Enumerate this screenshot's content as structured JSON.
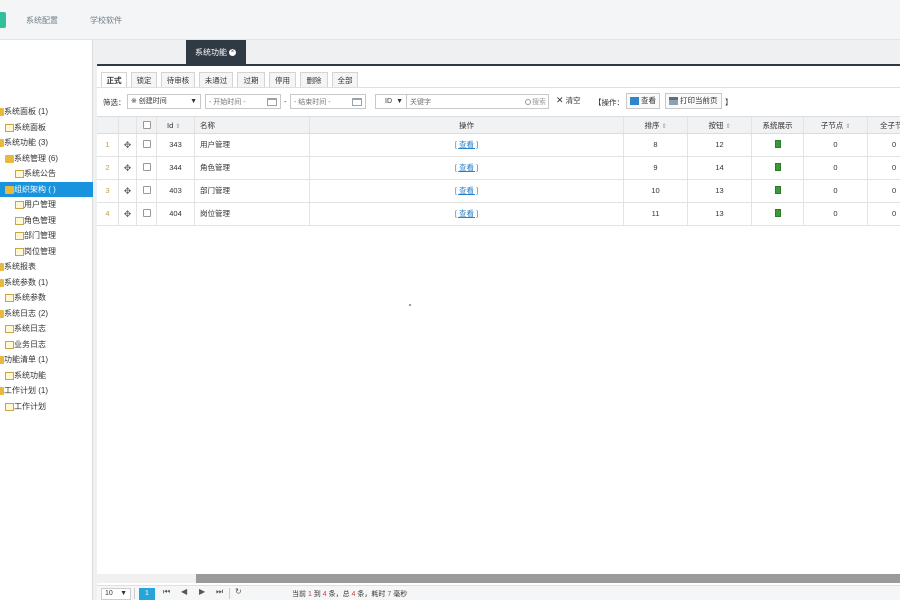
{
  "topnav": {
    "items": [
      {
        "label": "系统配置"
      },
      {
        "label": "学校软件"
      }
    ]
  },
  "sidebar": {
    "items": [
      {
        "label": "系统面板 (1)",
        "level": 0,
        "icon": "folder-icon",
        "selected": false
      },
      {
        "label": "系统面板",
        "level": 1,
        "icon": "document-icon",
        "selected": false
      },
      {
        "label": "系统功能 (3)",
        "level": 0,
        "icon": "folder-icon",
        "selected": false
      },
      {
        "label": "系统管理 (6)",
        "level": 1,
        "icon": "folder-icon",
        "selected": false
      },
      {
        "label": "系统公告",
        "level": 2,
        "icon": "document-icon",
        "selected": false
      },
      {
        "label": "组织架构 ( )",
        "level": 1,
        "icon": "folder-open-icon",
        "selected": true
      },
      {
        "label": "用户管理",
        "level": 2,
        "icon": "document-icon",
        "selected": false
      },
      {
        "label": "角色管理",
        "level": 2,
        "icon": "document-icon",
        "selected": false
      },
      {
        "label": "部门管理",
        "level": 2,
        "icon": "document-icon",
        "selected": false
      },
      {
        "label": "岗位管理",
        "level": 2,
        "icon": "document-icon",
        "selected": false
      },
      {
        "label": "系统报表",
        "level": 0,
        "icon": "folder-icon",
        "selected": false
      },
      {
        "label": "系统参数 (1)",
        "level": 0,
        "icon": "folder-icon",
        "selected": false
      },
      {
        "label": "系统参数",
        "level": 1,
        "icon": "document-icon",
        "selected": false
      },
      {
        "label": "系统日志 (2)",
        "level": 0,
        "icon": "folder-icon",
        "selected": false
      },
      {
        "label": "系统日志",
        "level": 1,
        "icon": "document-icon",
        "selected": false
      },
      {
        "label": "业务日志",
        "level": 1,
        "icon": "document-icon",
        "selected": false
      },
      {
        "label": "功能清单 (1)",
        "level": 0,
        "icon": "folder-icon",
        "selected": false
      },
      {
        "label": "系统功能",
        "level": 1,
        "icon": "document-icon",
        "selected": false
      },
      {
        "label": "工作计划 (1)",
        "level": 0,
        "icon": "folder-icon",
        "selected": false
      },
      {
        "label": "工作计划",
        "level": 1,
        "icon": "document-icon",
        "selected": false
      }
    ]
  },
  "tab": {
    "label": "系统功能",
    "close": "×"
  },
  "status_tabs": [
    {
      "label": "正式",
      "active": true
    },
    {
      "label": "锁定",
      "active": false
    },
    {
      "label": "待审核",
      "active": false
    },
    {
      "label": "未通过",
      "active": false
    },
    {
      "label": "过期",
      "active": false
    },
    {
      "label": "停用",
      "active": false
    },
    {
      "label": "删除",
      "active": false
    },
    {
      "label": "全部",
      "active": false
    }
  ],
  "filter": {
    "label": "筛选：",
    "field_select": "※ 创建时间",
    "start_placeholder": "- 开始时间 -",
    "dash": "-",
    "end_placeholder": "- 结束时间 -",
    "id_select": "ID",
    "keyword_placeholder": "关键字",
    "search_label": "搜索",
    "clear_label": "清空",
    "ops_open": "【操作：",
    "view_label": "查看",
    "print_label": "打印当前页",
    "ops_close": "】"
  },
  "grid": {
    "columns": [
      "Id",
      "名称",
      "操作",
      "排序",
      "按钮",
      "系统展示",
      "子节点",
      "全子节"
    ],
    "rows": [
      {
        "num": "1",
        "id": "343",
        "name": "用户管理",
        "action": "[ 查看 ]",
        "sort": "8",
        "buttons": "12",
        "children": "0",
        "all_children": "0"
      },
      {
        "num": "2",
        "id": "344",
        "name": "角色管理",
        "action": "[ 查看 ]",
        "sort": "9",
        "buttons": "14",
        "children": "0",
        "all_children": "0"
      },
      {
        "num": "3",
        "id": "403",
        "name": "部门管理",
        "action": "[ 查看 ]",
        "sort": "10",
        "buttons": "13",
        "children": "0",
        "all_children": "0"
      },
      {
        "num": "4",
        "id": "404",
        "name": "岗位管理",
        "action": "[ 查看 ]",
        "sort": "11",
        "buttons": "13",
        "children": "0",
        "all_children": "0"
      }
    ]
  },
  "pager": {
    "page_size": "10",
    "current_page": "1",
    "info": {
      "p1": "当前 ",
      "from": "1",
      "p2": " 到 ",
      "to": "4",
      "p3": " 条，总 ",
      "total": "4",
      "p4": " 条，耗时 ",
      "ms": "7",
      "p5": " 毫秒"
    }
  },
  "colors": {
    "accent": "#1794dd",
    "tab_dark": "#2f3a45",
    "page_active": "#26a5d8",
    "row_number": "#c7a03f"
  }
}
